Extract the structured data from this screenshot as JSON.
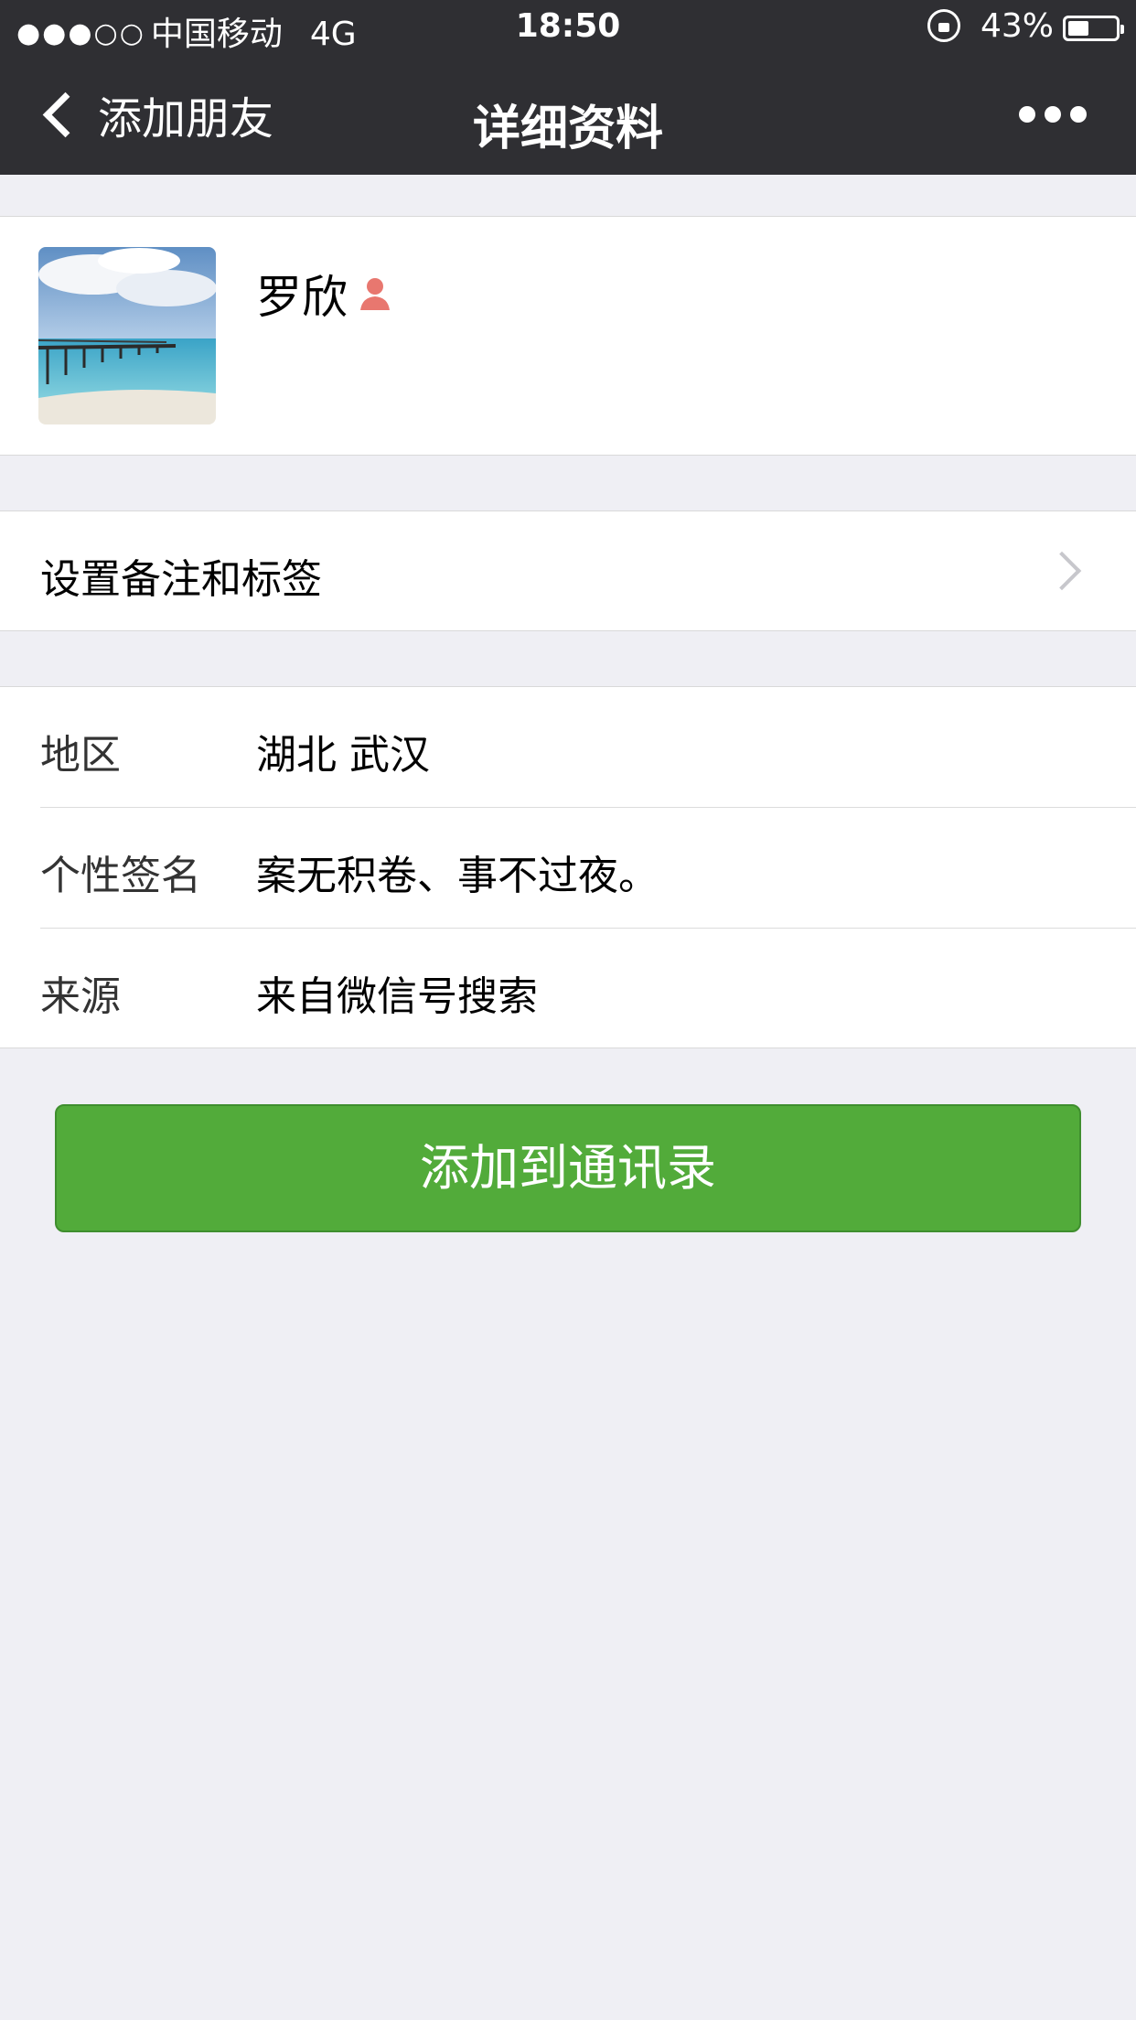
{
  "status_bar": {
    "signal": "●●●○○",
    "carrier": "中国移动",
    "network": "4G",
    "time": "18:50",
    "battery_text": "43%",
    "battery_level": 0.43
  },
  "nav": {
    "back_label": "添加朋友",
    "title": "详细资料"
  },
  "profile": {
    "name": "罗欣",
    "gender_icon": "female-icon",
    "gender_color": "#e8776f"
  },
  "remark": {
    "label": "设置备注和标签"
  },
  "info": {
    "rows": [
      {
        "key": "地区",
        "value": "湖北 武汉"
      },
      {
        "key": "个性签名",
        "value": "案无积卷、事不过夜。"
      },
      {
        "key": "来源",
        "value": "来自微信号搜索"
      }
    ]
  },
  "actions": {
    "add_label": "添加到通讯录"
  },
  "colors": {
    "navbar": "#2f2f33",
    "background": "#efeff4",
    "primary_button": "#52ab3a"
  }
}
